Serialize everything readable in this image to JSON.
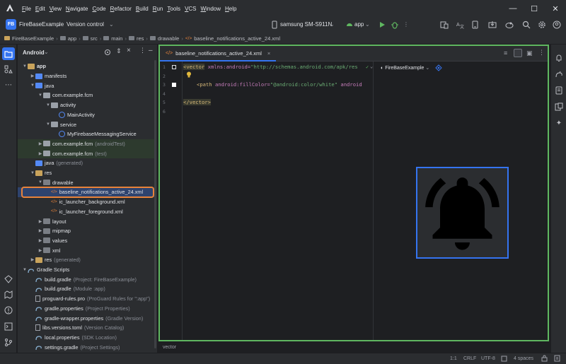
{
  "menu": [
    "File",
    "Edit",
    "View",
    "Navigate",
    "Code",
    "Refactor",
    "Build",
    "Run",
    "Tools",
    "VCS",
    "Window",
    "Help"
  ],
  "toolbar": {
    "project_badge": "FB",
    "project_name": "FireBaseExample",
    "version_control": "Version control",
    "device": "samsung SM-S911N",
    "run_config": "app"
  },
  "breadcrumb": [
    "FireBaseExample",
    "app",
    "src",
    "main",
    "res",
    "drawable",
    "baseline_notifications_active_24.xml"
  ],
  "project_panel": {
    "view_selector": "Android",
    "tree": [
      {
        "label": "app",
        "suffix": "",
        "indent": 0,
        "chevron": "open",
        "icon": "folder-gold",
        "bold": true
      },
      {
        "label": "manifests",
        "suffix": "",
        "indent": 1,
        "chevron": "closed",
        "icon": "folder-blue"
      },
      {
        "label": "java",
        "suffix": "",
        "indent": 1,
        "chevron": "open",
        "icon": "folder-blue"
      },
      {
        "label": "com.example.fcm",
        "suffix": "",
        "indent": 2,
        "chevron": "open",
        "icon": "package"
      },
      {
        "label": "activity",
        "suffix": "",
        "indent": 3,
        "chevron": "open",
        "icon": "package"
      },
      {
        "label": "MainActivity",
        "suffix": "",
        "indent": 4,
        "chevron": "none",
        "icon": "class"
      },
      {
        "label": "service",
        "suffix": "",
        "indent": 3,
        "chevron": "open",
        "icon": "package"
      },
      {
        "label": "MyFirebaseMessagingService",
        "suffix": "",
        "indent": 4,
        "chevron": "none",
        "icon": "class"
      },
      {
        "label": "com.example.fcm",
        "suffix": "(androidTest)",
        "indent": 2,
        "chevron": "closed",
        "icon": "package",
        "green": true
      },
      {
        "label": "com.example.fcm",
        "suffix": "(test)",
        "indent": 2,
        "chevron": "closed",
        "icon": "package",
        "green": true
      },
      {
        "label": "java",
        "suffix": "(generated)",
        "indent": 1,
        "chevron": "none",
        "icon": "folder-blue"
      },
      {
        "label": "res",
        "suffix": "",
        "indent": 1,
        "chevron": "open",
        "icon": "folder-gold"
      },
      {
        "label": "drawable",
        "suffix": "",
        "indent": 2,
        "chevron": "open",
        "icon": "folder"
      },
      {
        "label": "baseline_notifications_active_24.xml",
        "suffix": "",
        "indent": 3,
        "chevron": "none",
        "icon": "xml",
        "selected": true
      },
      {
        "label": "ic_launcher_background.xml",
        "suffix": "",
        "indent": 3,
        "chevron": "none",
        "icon": "xml"
      },
      {
        "label": "ic_launcher_foreground.xml",
        "suffix": "",
        "indent": 3,
        "chevron": "none",
        "icon": "xml"
      },
      {
        "label": "layout",
        "suffix": "",
        "indent": 2,
        "chevron": "closed",
        "icon": "folder"
      },
      {
        "label": "mipmap",
        "suffix": "",
        "indent": 2,
        "chevron": "closed",
        "icon": "folder"
      },
      {
        "label": "values",
        "suffix": "",
        "indent": 2,
        "chevron": "closed",
        "icon": "folder"
      },
      {
        "label": "xml",
        "suffix": "",
        "indent": 2,
        "chevron": "closed",
        "icon": "folder"
      },
      {
        "label": "res",
        "suffix": "(generated)",
        "indent": 1,
        "chevron": "closed",
        "icon": "folder-gold"
      },
      {
        "label": "Gradle Scripts",
        "suffix": "",
        "indent": 0,
        "chevron": "open",
        "icon": "gradle"
      },
      {
        "label": "build.gradle",
        "suffix": "(Project: FireBaseExample)",
        "indent": 1,
        "chevron": "none",
        "icon": "gradle"
      },
      {
        "label": "build.gradle",
        "suffix": "(Module :app)",
        "indent": 1,
        "chevron": "none",
        "icon": "gradle"
      },
      {
        "label": "proguard-rules.pro",
        "suffix": "(ProGuard Rules for \":app\")",
        "indent": 1,
        "chevron": "none",
        "icon": "file"
      },
      {
        "label": "gradle.properties",
        "suffix": "(Project Properties)",
        "indent": 1,
        "chevron": "none",
        "icon": "gradle"
      },
      {
        "label": "gradle-wrapper.properties",
        "suffix": "(Gradle Version)",
        "indent": 1,
        "chevron": "none",
        "icon": "gradle"
      },
      {
        "label": "libs.versions.toml",
        "suffix": "(Version Catalog)",
        "indent": 1,
        "chevron": "none",
        "icon": "file"
      },
      {
        "label": "local.properties",
        "suffix": "(SDK Location)",
        "indent": 1,
        "chevron": "none",
        "icon": "gradle"
      },
      {
        "label": "settings.gradle",
        "suffix": "(Project Settings)",
        "indent": 1,
        "chevron": "none",
        "icon": "gradle"
      }
    ]
  },
  "editor": {
    "tab_label": "baseline_notifications_active_24.xml",
    "line_numbers": [
      "1",
      "2",
      "3",
      "4",
      "5",
      "6"
    ],
    "line1": {
      "open": "<vector",
      "ns": " xmlns:android=",
      "val": "\"http://schemas.android.com/apk/res"
    },
    "line3": {
      "open": "<path",
      "ns": " android:fillColor=",
      "val": "\"@android:color/white\"",
      "tail": " android"
    },
    "line5": "</vector>",
    "preview_theme": "FireBaseExample",
    "footer_label": "vector"
  },
  "status": {
    "position": "1:1",
    "line_sep": "CRLF",
    "encoding": "UTF-8",
    "indent": "4 spaces"
  },
  "colors": {
    "accent_blue": "#3574f0",
    "highlight_green": "#5fb760",
    "selection_orange": "#e8833a"
  }
}
